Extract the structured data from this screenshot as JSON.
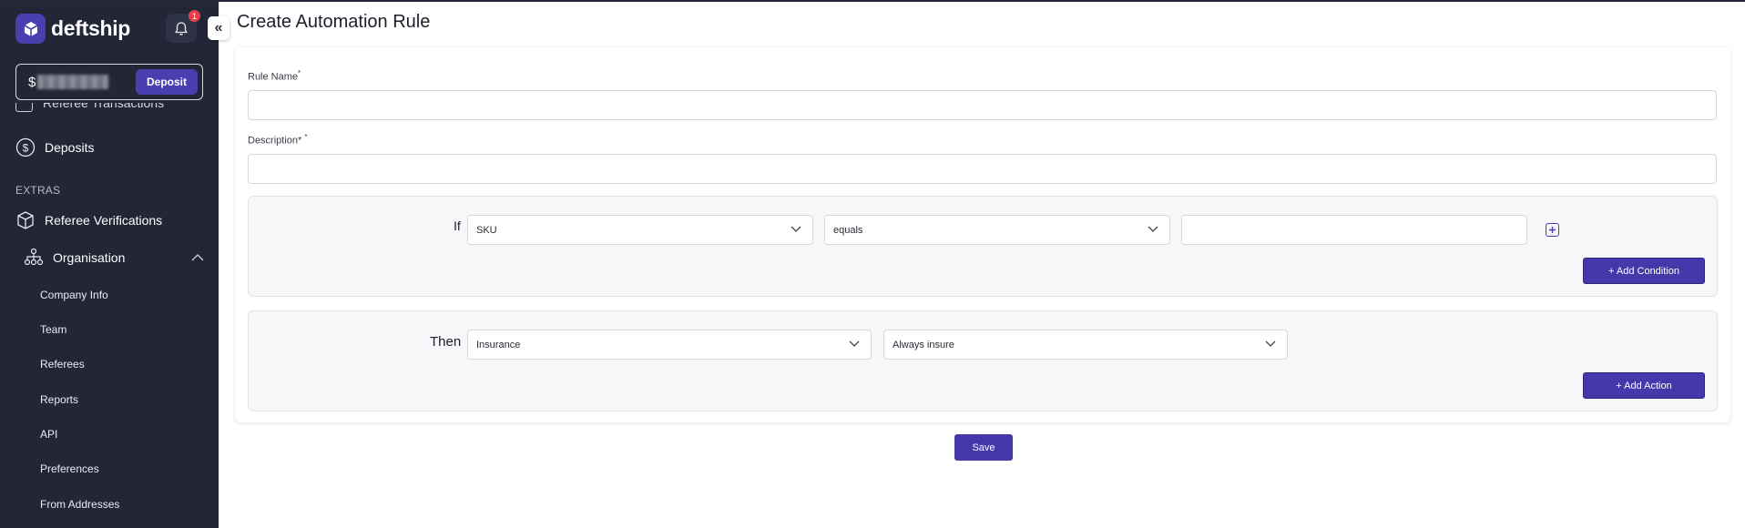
{
  "brand": {
    "name": "deftship",
    "logo_icon": "box-icon",
    "accent": "#4a3fb0"
  },
  "notifications": {
    "count": "1"
  },
  "balance": {
    "currency": "$",
    "deposit_label": "Deposit"
  },
  "sidebar": {
    "cut_item": "Referee Transactions",
    "deposits_label": "Deposits",
    "section_extras": "EXTRAS",
    "referee_verifications_label": "Referee Verifications",
    "organisation_label": "Organisation",
    "sub_items": [
      "Company Info",
      "Team",
      "Referees",
      "Reports",
      "API",
      "Preferences",
      "From Addresses"
    ]
  },
  "page": {
    "title": "Create Automation Rule"
  },
  "form": {
    "rule_name_label": "Rule Name",
    "rule_name_required": "*",
    "rule_name_value": "",
    "description_label": "Description*",
    "description_required": "*",
    "description_value": "",
    "if_label": "If",
    "condition_field": "SKU",
    "condition_operator": "equals",
    "condition_value": "",
    "add_condition_label": "+ Add Condition",
    "then_label": "Then",
    "action_type": "Insurance",
    "action_value": "Always insure",
    "add_action_label": "+ Add Action",
    "save_label": "Save"
  }
}
